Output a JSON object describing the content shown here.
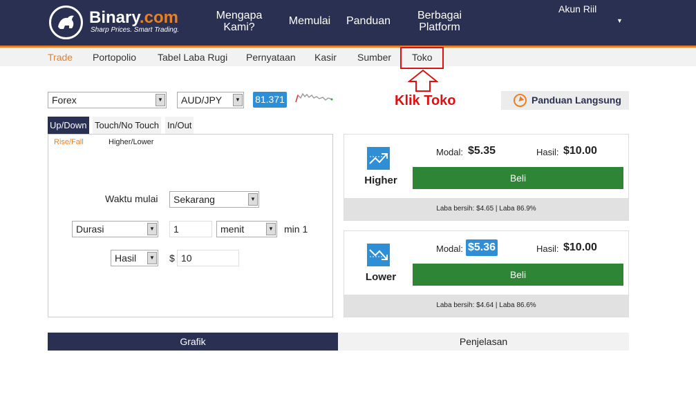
{
  "brand": {
    "name_main": "Binary",
    "name_dot": ".com",
    "tagline": "Sharp Prices. Smart Trading."
  },
  "topnav": [
    {
      "line1": "Mengapa",
      "line2": "Kami?"
    },
    {
      "line1": "Memulai",
      "line2": ""
    },
    {
      "line1": "Panduan",
      "line2": ""
    },
    {
      "line1": "Berbagai",
      "line2": "Platform"
    }
  ],
  "account": {
    "label": "Akun Riil",
    "caret": "▼"
  },
  "subnav": [
    "Trade",
    "Portopolio",
    "Tabel Laba Rugi",
    "Pernyataan",
    "Kasir",
    "Sumber",
    "Toko"
  ],
  "annotation": {
    "text": "Klik Toko"
  },
  "market": {
    "value": "Forex",
    "caret": "▼"
  },
  "symbol": {
    "value": "AUD/JPY",
    "caret": "▼"
  },
  "spot_price": "81.371",
  "guide": {
    "label": "Panduan Langsung"
  },
  "tabs": [
    "Up/Down",
    "Touch/No Touch",
    "In/Out"
  ],
  "subtabs": [
    "Rise/Fall",
    "Higher/Lower"
  ],
  "form": {
    "start_label": "Waktu mulai",
    "start_value": "Sekarang",
    "duration_type": "Durasi",
    "duration_amount": "1",
    "duration_unit": "menit",
    "duration_min": "min 1",
    "payout_type": "Hasil",
    "currency": "$",
    "amount": "10",
    "caret": "▼"
  },
  "contracts": [
    {
      "name": "Higher",
      "stake_label": "Modal:",
      "stake": "$5.35",
      "payout_label": "Hasil:",
      "payout": "$10.00",
      "buy": "Beli",
      "footer": "Laba bersih: $4.65 | Laba 86.9%"
    },
    {
      "name": "Lower",
      "stake_label": "Modal:",
      "stake": "$5.36",
      "payout_label": "Hasil:",
      "payout": "$10.00",
      "buy": "Beli",
      "footer": "Laba bersih: $4.64 | Laba 86.6%"
    }
  ],
  "bottom_tabs": [
    "Grafik",
    "Penjelasan"
  ],
  "colors": {
    "navy": "#2a3052",
    "orange": "#e98024",
    "blue": "#2e8fd6",
    "green": "#2e8535",
    "red": "#e01010"
  }
}
